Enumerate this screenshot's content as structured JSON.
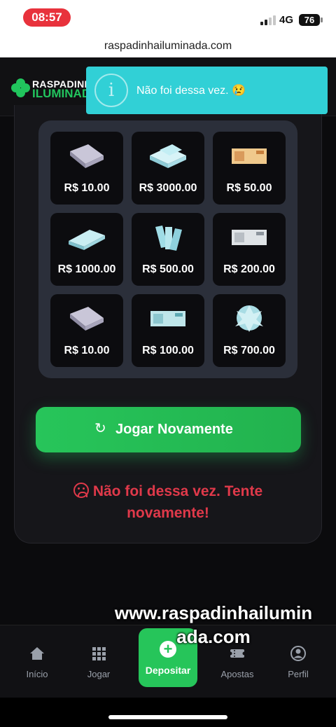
{
  "status_bar": {
    "time": "08:57",
    "network": "4G",
    "battery": "76"
  },
  "browser": {
    "url": "raspadinhailuminada.com"
  },
  "header": {
    "logo_top": "RASPADINHA",
    "logo_bottom": "ILUMINADA"
  },
  "toast": {
    "message": "Não foi dessa vez. 😢"
  },
  "game": {
    "tiles": [
      {
        "amount": "R$ 10.00",
        "art": "stack-icon"
      },
      {
        "amount": "R$ 3000.00",
        "art": "stack-icon"
      },
      {
        "amount": "R$ 50.00",
        "art": "note-icon"
      },
      {
        "amount": "R$ 1000.00",
        "art": "stack-icon"
      },
      {
        "amount": "R$ 500.00",
        "art": "fan-icon"
      },
      {
        "amount": "R$ 200.00",
        "art": "note-icon"
      },
      {
        "amount": "R$ 10.00",
        "art": "stack-icon"
      },
      {
        "amount": "R$ 100.00",
        "art": "note-icon"
      },
      {
        "amount": "R$ 700.00",
        "art": "pile-icon"
      }
    ],
    "play_again": "Jogar Novamente",
    "result_line1": "Não foi dessa vez. Tente",
    "result_line2": "novamente!"
  },
  "watermark": {
    "line1": "www.raspadinhailumin",
    "line2": "ada.com"
  },
  "nav": {
    "inicio": "Início",
    "jogar": "Jogar",
    "depositar": "Depositar",
    "apostas": "Apostas",
    "perfil": "Perfil"
  },
  "colors": {
    "accent": "#22c55e",
    "toast": "#31d0d6",
    "error": "#e0394a"
  }
}
